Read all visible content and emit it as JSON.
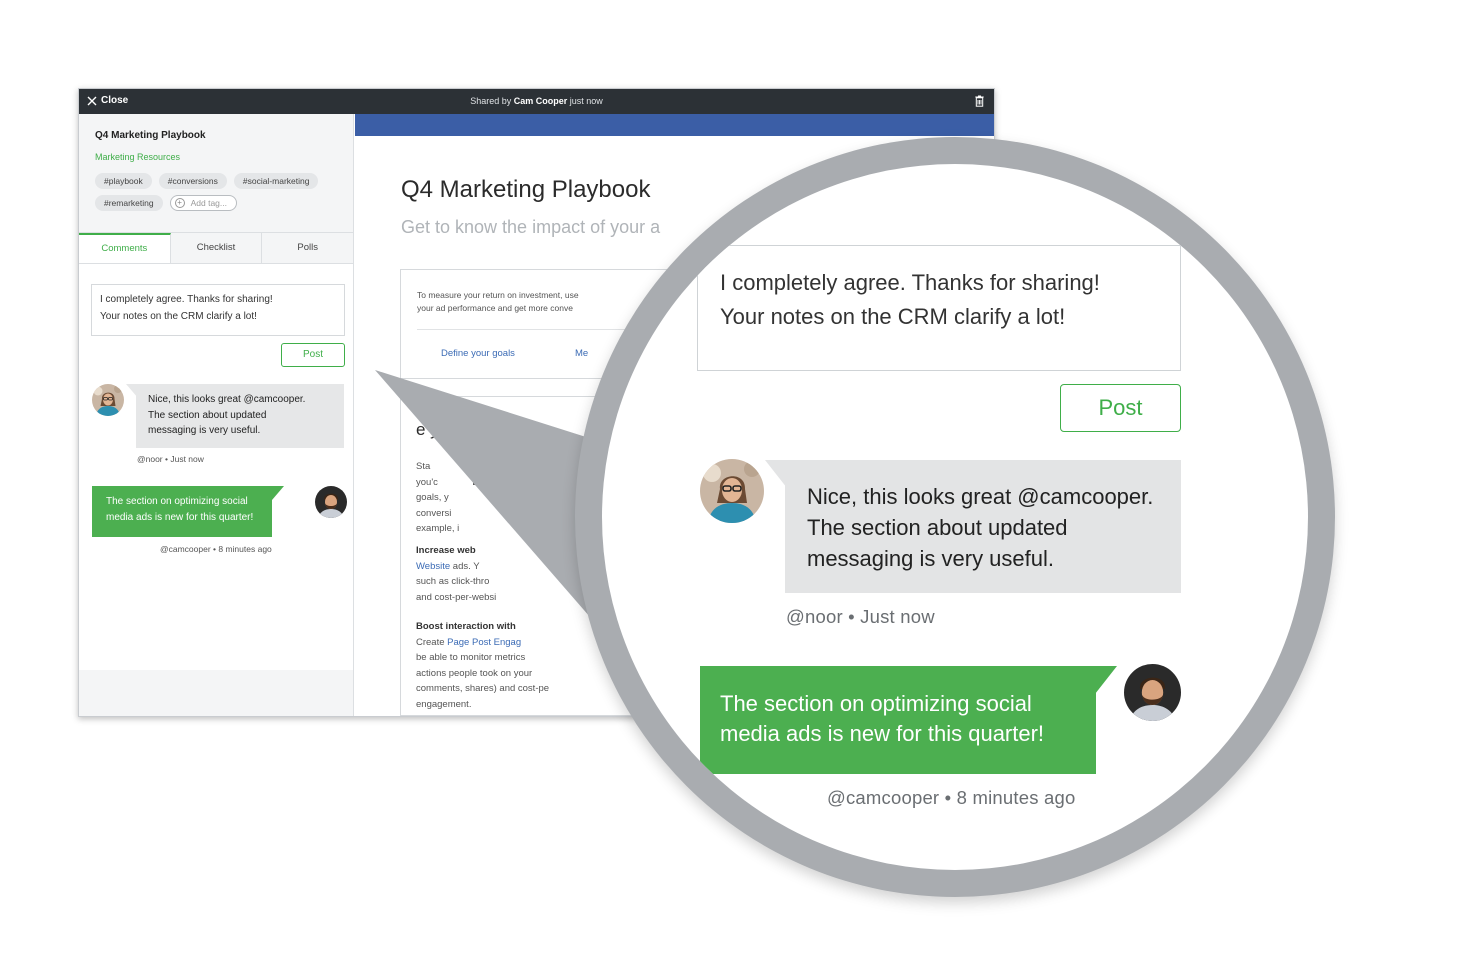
{
  "titlebar": {
    "close_label": "Close",
    "shared_prefix": "Shared by",
    "shared_user": "Cam Cooper",
    "shared_time": "just now"
  },
  "sidebar": {
    "doc_title": "Q4 Marketing Playbook",
    "folder": "Marketing Resources",
    "tags": [
      "#playbook",
      "#conversions",
      "#social-marketing",
      "#remarketing"
    ],
    "add_tag_placeholder": "Add tag...",
    "tabs": [
      {
        "label": "Comments",
        "active": true
      },
      {
        "label": "Checklist",
        "active": false
      },
      {
        "label": "Polls",
        "active": false
      }
    ]
  },
  "comment_input": {
    "line1": "I completely agree. Thanks for sharing!",
    "line2": "Your notes on the CRM clarify a lot!"
  },
  "post_label": "Post",
  "comments": [
    {
      "lines": [
        "Nice, this looks great @camcooper.",
        "The section about updated",
        "messaging is very useful."
      ],
      "meta": "@noor • Just now"
    },
    {
      "lines": [
        "The section on optimizing social",
        "media ads is new for this quarter!"
      ],
      "meta": "@camcooper • 8 minutes ago"
    }
  ],
  "document": {
    "title": "Q4 Marketing Playbook",
    "subtitle": "Get to know the impact of your a",
    "card1_line1": "To measure your return on investment, use",
    "card1_line2": "your ad performance and get more conve",
    "link1": "Define your goals",
    "link2": "Me",
    "section_heading": "e your goal",
    "para1": [
      "Sta              which kin",
      "you'c             Bas",
      "goals, y",
      "conversi",
      "example, i"
    ],
    "sub1_head": "Increase web",
    "sub1_link": "Website",
    "sub1_rest": " ads. Y",
    "sub1_lines": [
      "such as click-thro",
      "and cost-per-websi"
    ],
    "sub2_head": "Boost interaction with",
    "sub2_prefix": "Create ",
    "sub2_link": "Page Post Engag",
    "sub2_lines": [
      "be able to monitor metrics",
      "actions people took on your",
      "comments, shares) and cost-pe",
      "engagement."
    ]
  },
  "colors": {
    "accent_green": "#4caf50",
    "titlebar": "#2c3136",
    "header_blue": "#3b5ea6",
    "magnifier_ring": "#a9acb0"
  }
}
